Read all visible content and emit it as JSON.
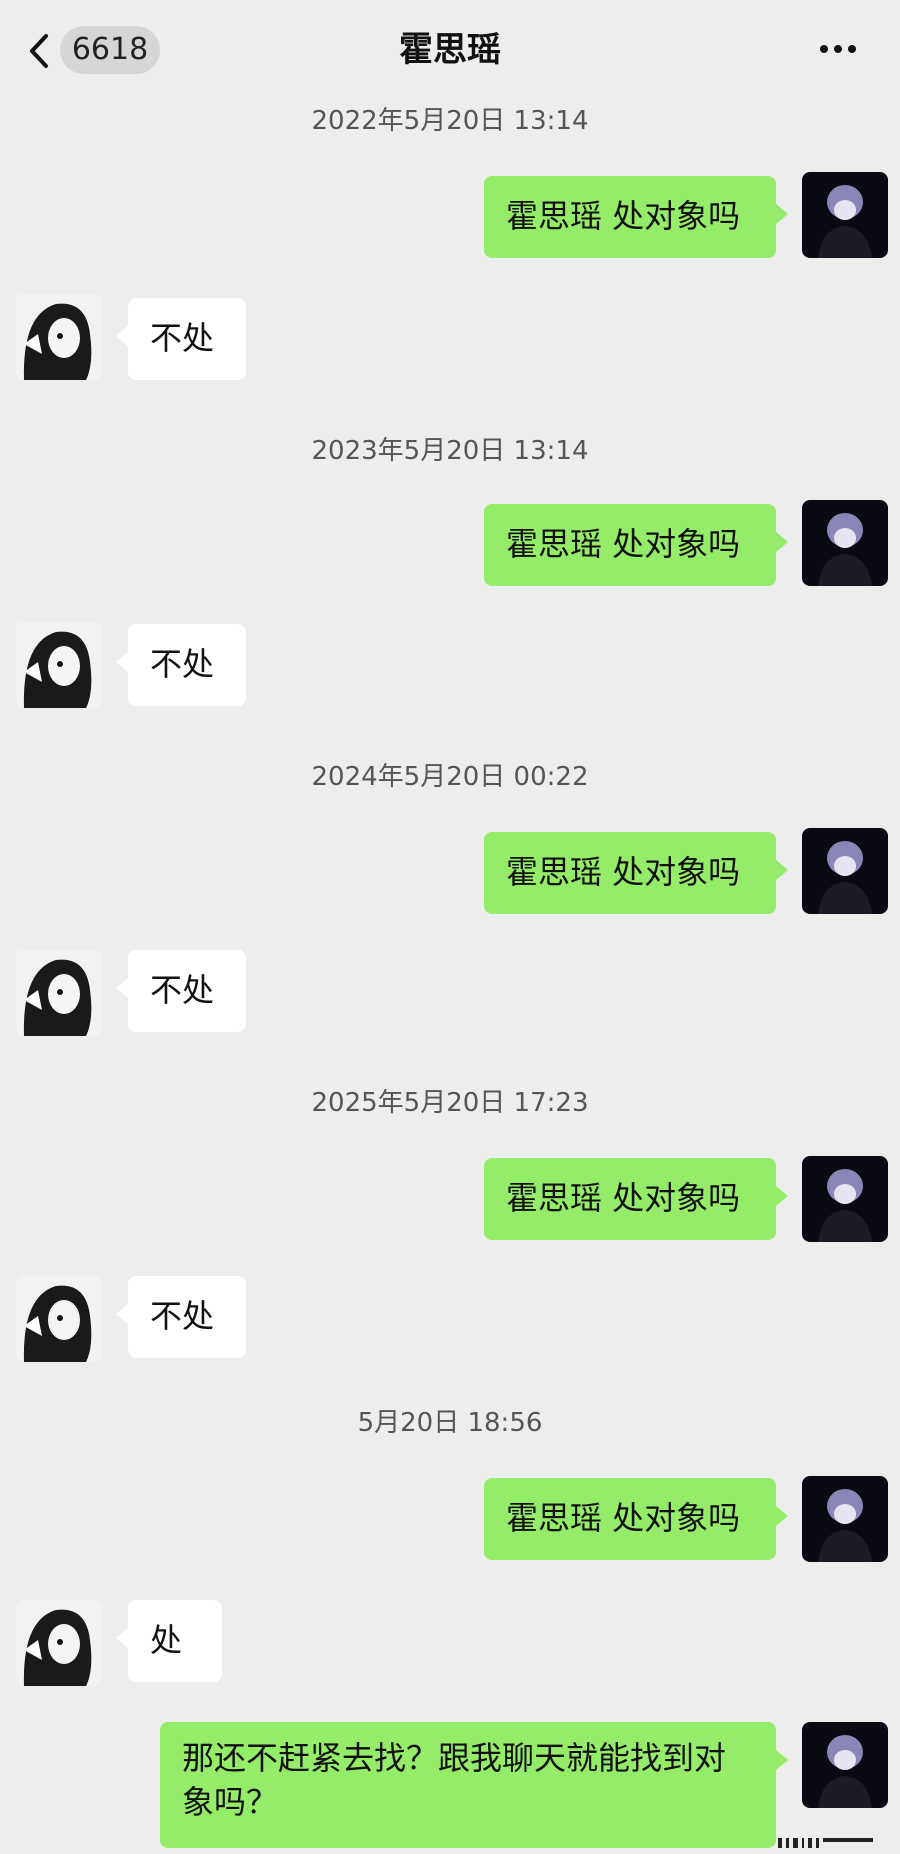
{
  "header": {
    "unread_count": "6618",
    "title": "霍思瑶"
  },
  "messages": [
    {
      "timestamp": "2022年5月20日 13:14",
      "sent": "霍思瑶 处对象吗",
      "reply": "不处"
    },
    {
      "timestamp": "2023年5月20日 13:14",
      "sent": "霍思瑶 处对象吗",
      "reply": "不处"
    },
    {
      "timestamp": "2024年5月20日 00:22",
      "sent": "霍思瑶 处对象吗",
      "reply": "不处"
    },
    {
      "timestamp": "2025年5月20日 17:23",
      "sent": "霍思瑶 处对象吗",
      "reply": "不处"
    },
    {
      "timestamp": "5月20日 18:56",
      "sent": "霍思瑶 处对象吗",
      "reply": "处"
    }
  ],
  "last_sent": {
    "line1": "那还不赶紧去找？跟我聊天就能找到对",
    "line2": "象吗？"
  },
  "colors": {
    "background": "#ededed",
    "sent_bubble": "#95ec69",
    "received_bubble": "#ffffff"
  }
}
